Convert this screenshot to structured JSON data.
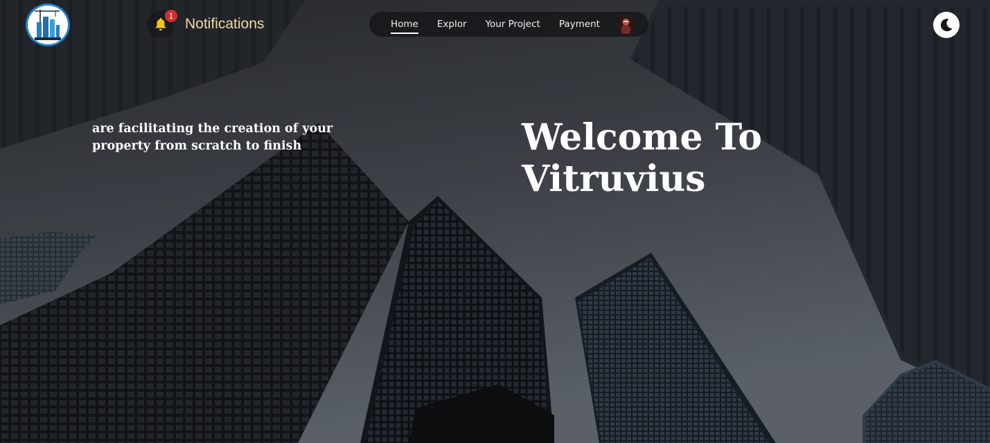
{
  "header": {
    "logo": {
      "icon": "vitruvius-logo",
      "brand_color": "#1f7fc4"
    },
    "notifications": {
      "icon": "bell-icon",
      "count": "1",
      "label": "Notifications",
      "label_color": "#f3d9a4",
      "badge_color": "#d32f2f"
    },
    "nav": {
      "items": [
        {
          "label": "Home",
          "active": true
        },
        {
          "label": "Explor",
          "active": false
        },
        {
          "label": "Your Project",
          "active": false
        },
        {
          "label": "Payment",
          "active": false
        }
      ],
      "avatar": {
        "icon": "user-avatar"
      }
    },
    "theme_toggle": {
      "icon": "moon-icon"
    }
  },
  "hero": {
    "tagline": "are facilitating the creation of your property from scratch to finish",
    "title": "Welcome To Vitruvius",
    "background": "skyscrapers-photo"
  }
}
